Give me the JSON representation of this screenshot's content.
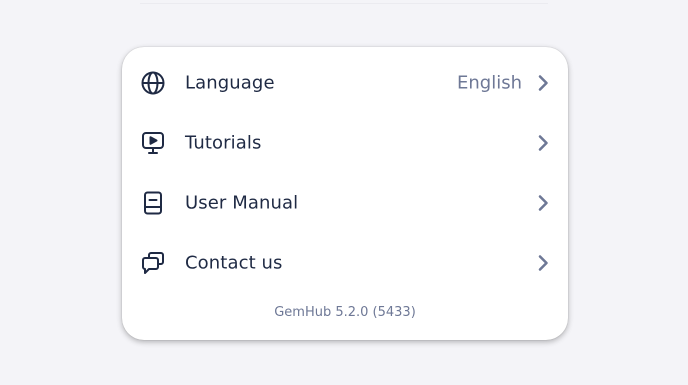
{
  "settings": {
    "items": [
      {
        "label": "Language",
        "value": "English",
        "icon": "globe-icon"
      },
      {
        "label": "Tutorials",
        "value": "",
        "icon": "play-screen-icon"
      },
      {
        "label": "User Manual",
        "value": "",
        "icon": "manual-book-icon"
      },
      {
        "label": "Contact us",
        "value": "",
        "icon": "chat-bubbles-icon"
      }
    ],
    "version": "GemHub 5.2.0 (5433)"
  },
  "colors": {
    "background": "#f4f4f8",
    "card": "#ffffff",
    "text_primary": "#1f2a44",
    "text_secondary": "#6e7896",
    "chevron": "#6e7896"
  }
}
